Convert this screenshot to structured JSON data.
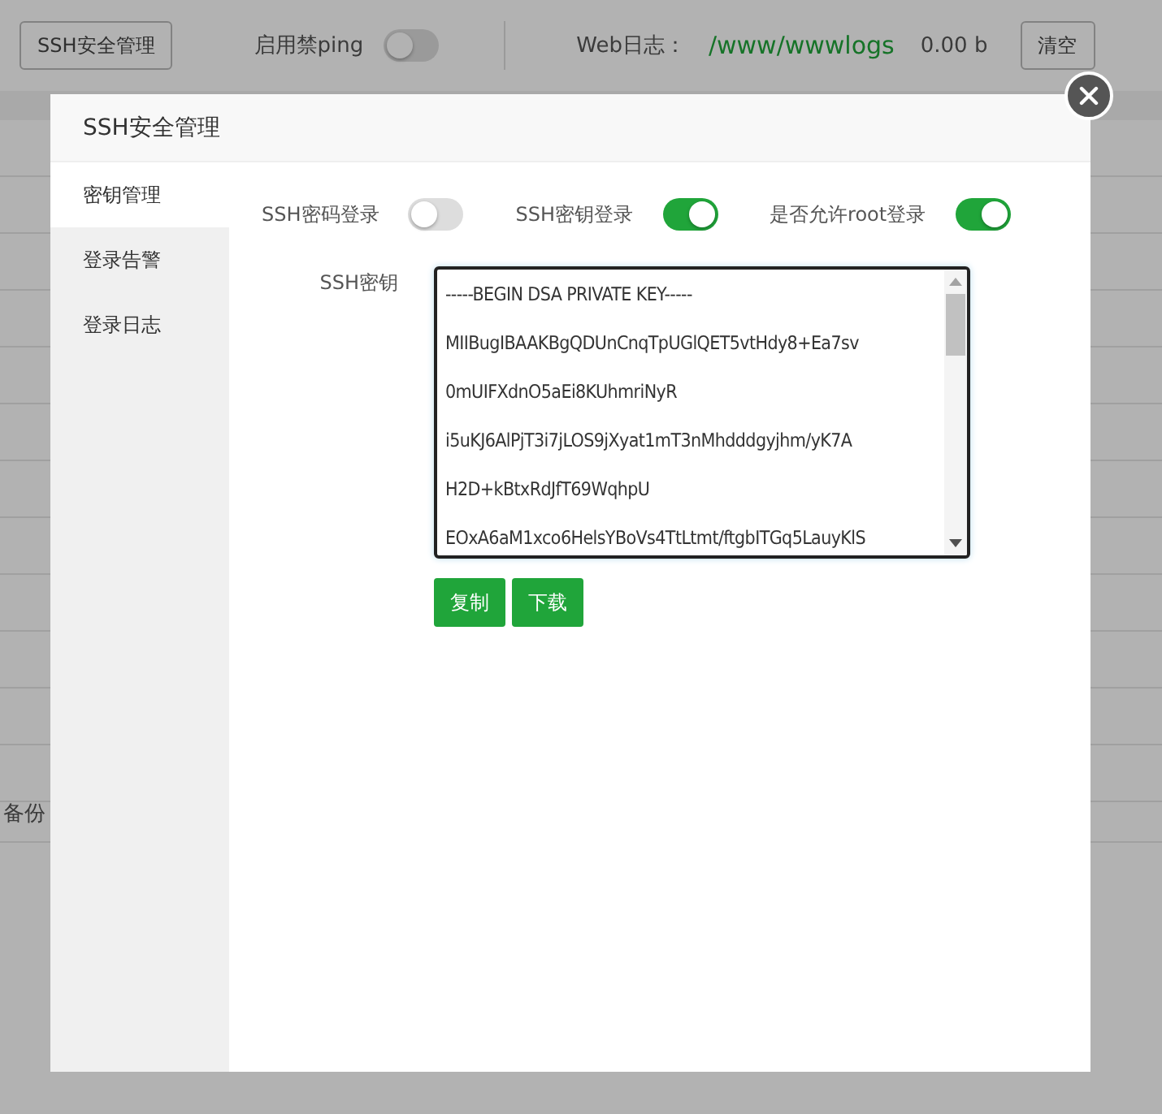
{
  "background": {
    "toolbar": {
      "ssh_button": "SSH安全管理",
      "ping_label": "启用禁ping",
      "ping_on": false,
      "log_label": "Web日志：",
      "log_path": "/www/wwwlogs",
      "log_size": "0.00 b",
      "clear_button": "清空"
    },
    "row_fragment": "备份"
  },
  "dialog": {
    "title": "SSH安全管理",
    "menu": [
      {
        "label": "密钥管理",
        "selected": true
      },
      {
        "label": "登录告警",
        "selected": false
      },
      {
        "label": "登录日志",
        "selected": false
      }
    ],
    "switches": [
      {
        "label": "SSH密码登录",
        "on": false
      },
      {
        "label": "SSH密钥登录",
        "on": true
      },
      {
        "label": "是否允许root登录",
        "on": true
      }
    ],
    "key_label": "SSH密钥",
    "key_lines": [
      "-----BEGIN DSA PRIVATE KEY-----",
      "MIIBugIBAAKBgQDUnCnqTpUGlQET5vtHdy8+Ea7sv",
      "0mUIFXdnO5aEi8KUhmriNyR",
      "i5uKJ6AlPjT3i7jLOS9jXyat1mT3nMhdddgyjhm/yK7A",
      "H2D+kBtxRdJfT69WqhpU",
      "EOxA6aM1xco6HelsYBoVs4TtLtmt/ftgbITGq5LauyKlS"
    ],
    "buttons": [
      "复制",
      "下载"
    ]
  }
}
